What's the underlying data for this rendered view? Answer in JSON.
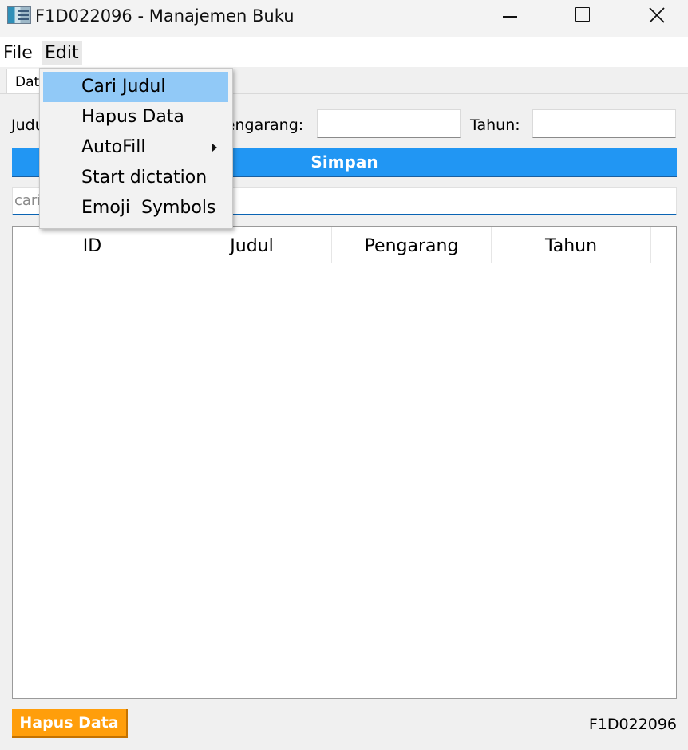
{
  "window": {
    "title": "F1D022096 - Manajemen Buku"
  },
  "menubar": {
    "file": "File",
    "edit": "Edit"
  },
  "tab": {
    "label": "Data Buku"
  },
  "form": {
    "judul_label": "Judul:",
    "pengarang_label": "Pengarang:",
    "tahun_label": "Tahun:",
    "judul_value": "",
    "pengarang_value": "",
    "tahun_value": "",
    "simpan_label": "Simpan"
  },
  "search": {
    "placeholder": "cari judul..."
  },
  "table": {
    "columns": [
      "ID",
      "Judul",
      "Pengarang",
      "Tahun"
    ],
    "rows": []
  },
  "footer": {
    "hapus_label": "Hapus Data",
    "student_id": "F1D022096"
  },
  "edit_menu": {
    "items": [
      {
        "label": "Cari Judul",
        "active": true
      },
      {
        "label": "Hapus Data"
      },
      {
        "label": "AutoFill",
        "submenu": true
      },
      {
        "label": "Start dictation"
      },
      {
        "label": "Emoji  Symbols"
      }
    ]
  },
  "colors": {
    "simpan": "#2196f3",
    "hapus": "#ff9e0b",
    "menu_highlight": "#91c9f7",
    "search_underline": "#0a64b4"
  }
}
